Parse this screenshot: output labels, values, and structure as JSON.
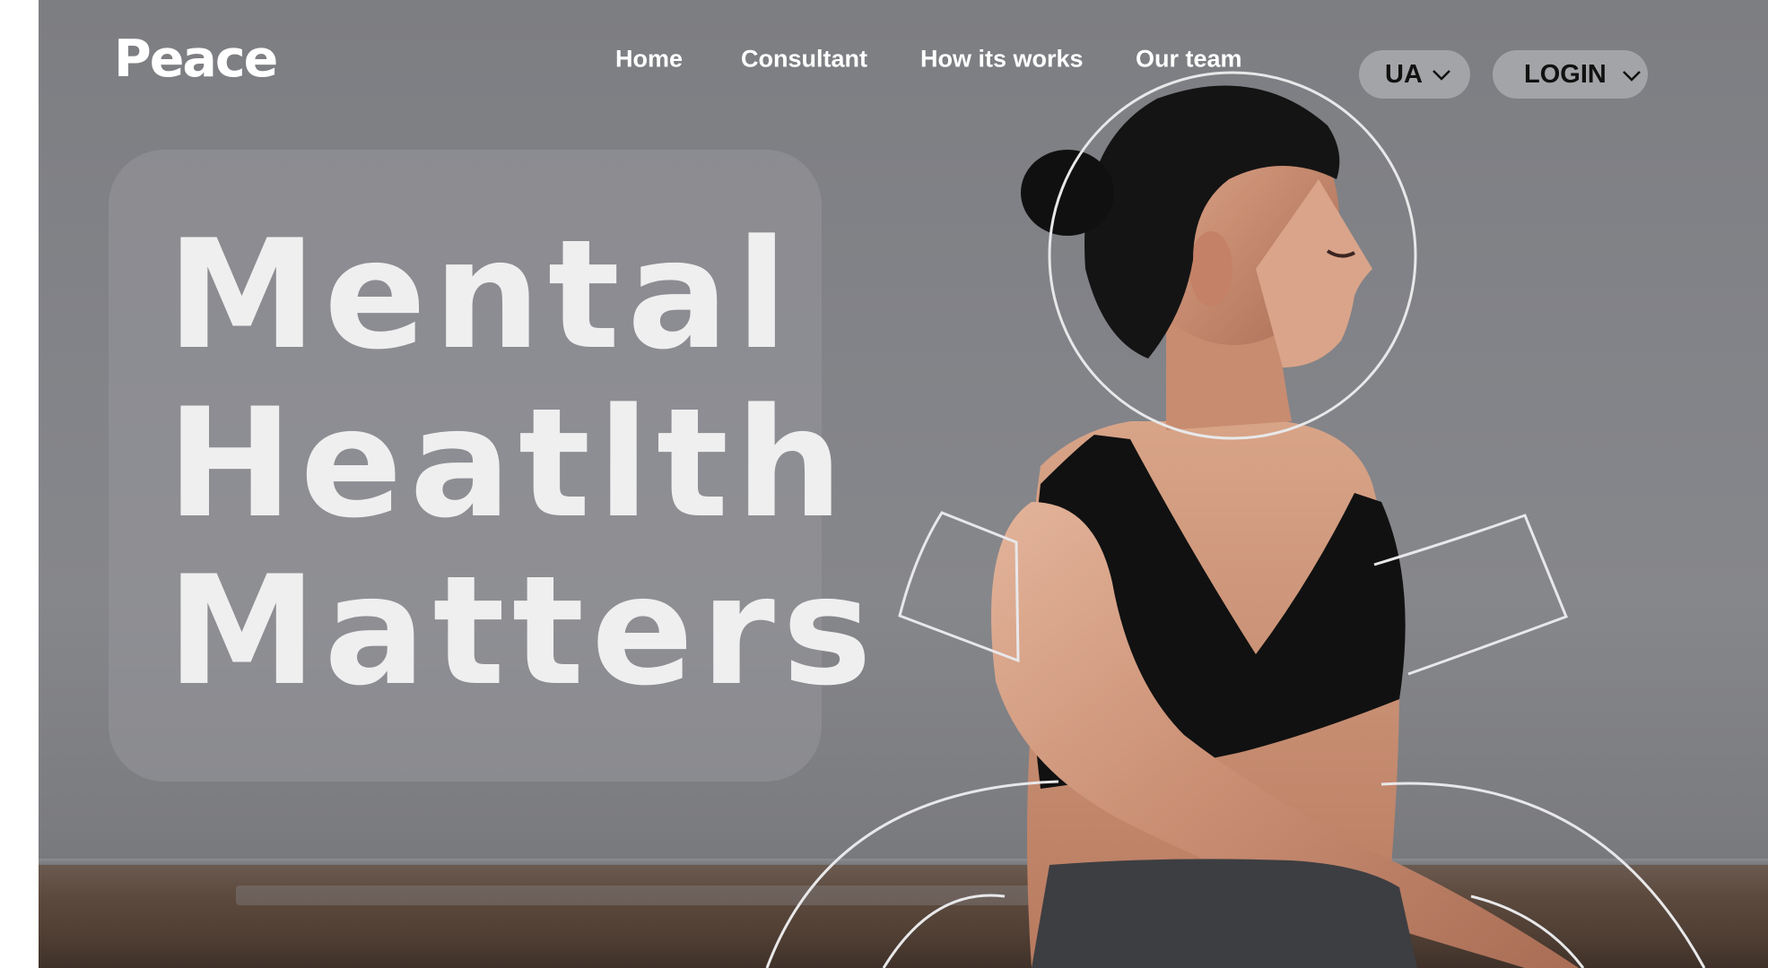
{
  "brand": {
    "logo_text": "Peace"
  },
  "nav": {
    "links": [
      {
        "label": "Home"
      },
      {
        "label": "Consultant"
      },
      {
        "label": "How its works"
      },
      {
        "label": "Our team"
      }
    ],
    "language": {
      "label": "UA",
      "icon": "chevron-down-icon"
    },
    "login": {
      "label": "LOGIN",
      "icon": "chevron-down-icon"
    }
  },
  "hero": {
    "headline_lines": [
      "Mental",
      "Heatlth",
      "Matters"
    ],
    "image_subject": "woman with dark hair bun in black sports top meditating, eyes closed, in profile",
    "overlay": "thin white line drawing of a figure (head circle, arms, legs) over the photo"
  },
  "colors": {
    "background": "#828388",
    "pill": "#a3a4a7",
    "text_light": "#ffffff",
    "headline": "#efeff0"
  }
}
